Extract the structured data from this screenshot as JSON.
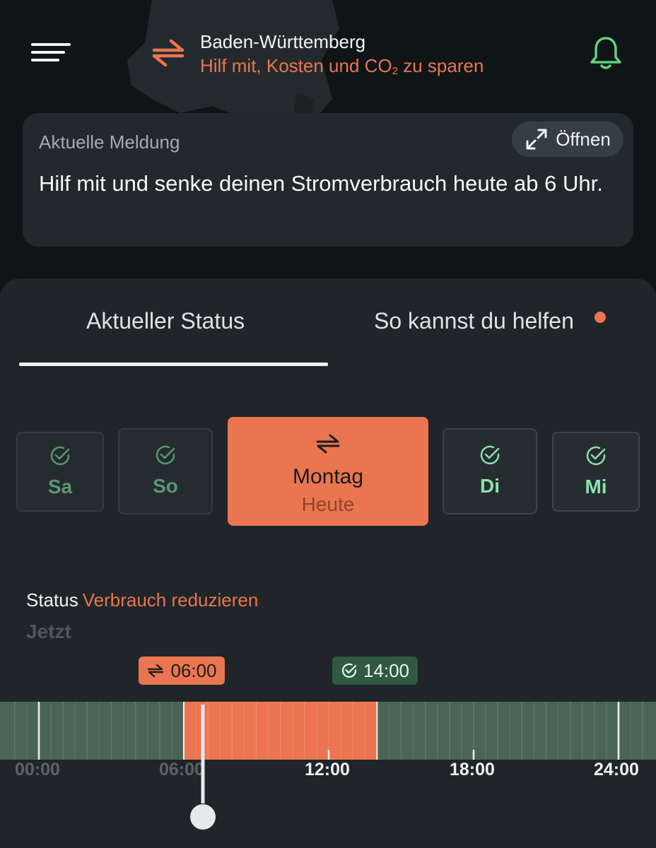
{
  "header": {
    "region": "Baden-Württemberg",
    "subtitle_prefix": "Hilf mit, Kosten und CO",
    "subtitle_sub": "2",
    "subtitle_suffix": " zu sparen",
    "icons": {
      "menu": "menu-icon",
      "region": "swap-arrows-icon",
      "notifications": "bell-icon"
    },
    "colors": {
      "accent": "#eb7550",
      "bell": "#5fd27f"
    }
  },
  "message": {
    "label": "Aktuelle Meldung",
    "open_label": "Öffnen",
    "text": "Hilf mit und senke deinen Stromverbrauch heute ab 6 Uhr."
  },
  "tabs": [
    {
      "label": "Aktueller Status",
      "active": true
    },
    {
      "label": "So kannst du helfen",
      "active": false,
      "has_dot": true
    }
  ],
  "days": [
    {
      "name": "Sa",
      "state": "ok"
    },
    {
      "name": "So",
      "state": "ok"
    },
    {
      "name": "Montag",
      "sub": "Heute",
      "state": "reduce"
    },
    {
      "name": "Di",
      "state": "ok"
    },
    {
      "name": "Mi",
      "state": "ok"
    }
  ],
  "status": {
    "key": "Status",
    "value": "Verbrauch reduzieren",
    "now_label": "Jetzt"
  },
  "timeline": {
    "start_marker": "06:00",
    "end_marker": "14:00",
    "ticks": [
      "00:00",
      "06:00",
      "12:00",
      "18:00",
      "24:00"
    ],
    "range_hours": [
      0,
      24
    ],
    "reduce_period_hours": [
      6,
      14
    ],
    "current_hour": 6.8,
    "colors": {
      "normal": "#4a6556",
      "reduce": "#eb7550"
    }
  }
}
